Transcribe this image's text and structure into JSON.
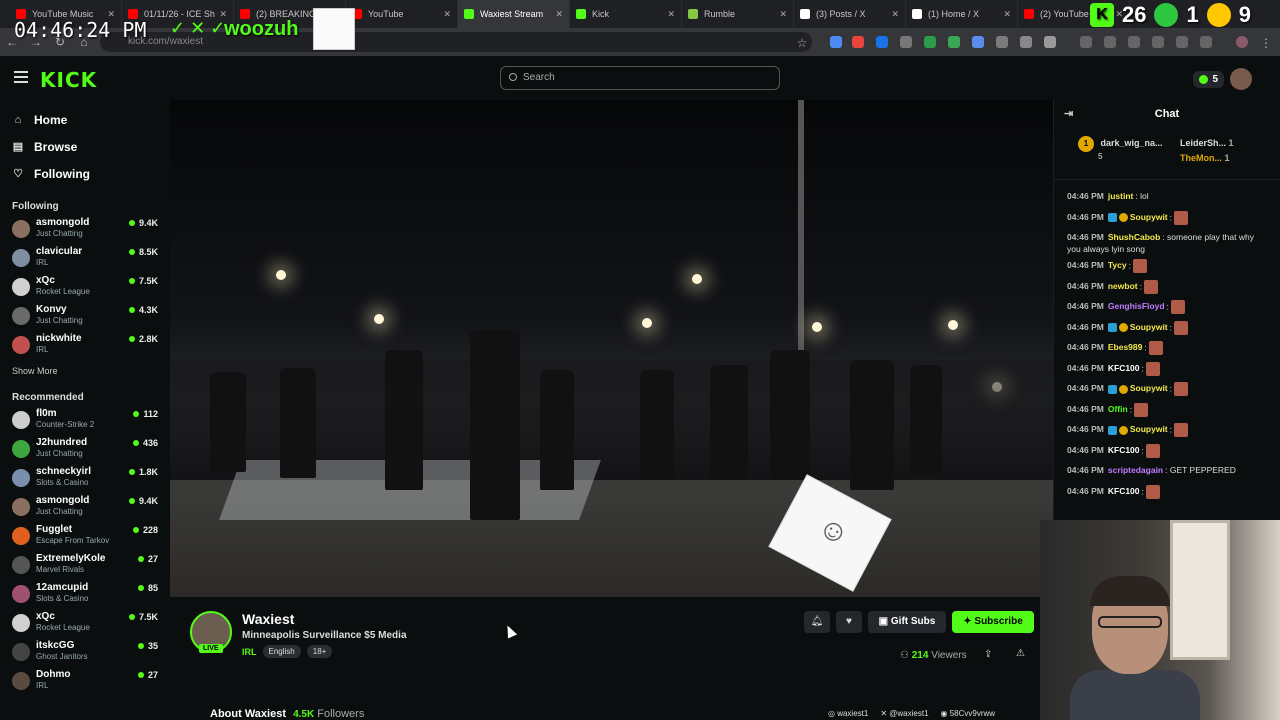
{
  "browser": {
    "tabs": [
      {
        "label": "YouTube Music",
        "color": "#ff0000",
        "active": false
      },
      {
        "label": "01/11/26 - ICE Sh",
        "color": "#ff0000",
        "active": false
      },
      {
        "label": "(2) BREAKING",
        "color": "#ff0000",
        "active": false
      },
      {
        "label": "YouTube",
        "color": "#ff0000",
        "active": false
      },
      {
        "label": "Waxiest Stream",
        "color": "#53fc18",
        "active": true
      },
      {
        "label": "Kick",
        "color": "#53fc18",
        "active": false
      },
      {
        "label": "Rumble",
        "color": "#85c742",
        "active": false
      },
      {
        "label": "(3) Posts / X",
        "color": "#ffffff",
        "active": false
      },
      {
        "label": "(1) Home / X",
        "color": "#ffffff",
        "active": false
      },
      {
        "label": "(2) YouTube",
        "color": "#ff0000",
        "active": false
      }
    ],
    "url": "kick.com/waxiest"
  },
  "overlay": {
    "clock": "04:46:24 PM",
    "handle": "woozuh",
    "counts": [
      "26",
      "1",
      "9"
    ]
  },
  "header": {
    "logo": "KICK",
    "search_placeholder": "Search",
    "kick_count": "5"
  },
  "sidebar": {
    "nav": [
      {
        "label": "Home",
        "icon": "home-icon",
        "glyph": "⌂"
      },
      {
        "label": "Browse",
        "icon": "browse-icon",
        "glyph": "▤"
      },
      {
        "label": "Following",
        "icon": "heart-icon",
        "glyph": "♡"
      }
    ],
    "following_title": "Following",
    "following": [
      {
        "name": "asmongold",
        "category": "Just Chatting",
        "viewers": "9.4K",
        "color": "#8a6f5f"
      },
      {
        "name": "clavicular",
        "category": "IRL",
        "viewers": "8.5K",
        "color": "#7d8fa0"
      },
      {
        "name": "xQc",
        "category": "Rocket League",
        "viewers": "7.5K",
        "color": "#d0d0d0"
      },
      {
        "name": "Konvy",
        "category": "Just Chatting",
        "viewers": "4.3K",
        "color": "#6a6a6a"
      },
      {
        "name": "nickwhite",
        "category": "IRL",
        "viewers": "2.8K",
        "color": "#c0504d"
      }
    ],
    "show_more": "Show More",
    "recommended_title": "Recommended",
    "recommended": [
      {
        "name": "fl0m",
        "category": "Counter-Strike 2",
        "viewers": "112",
        "color": "#cccccc"
      },
      {
        "name": "J2hundred",
        "category": "Just Chatting",
        "viewers": "436",
        "color": "#3fa53f"
      },
      {
        "name": "schneckyirl",
        "category": "Slots & Casino",
        "viewers": "1.8K",
        "color": "#7a8fb0"
      },
      {
        "name": "asmongold",
        "category": "Just Chatting",
        "viewers": "9.4K",
        "color": "#8a6f5f"
      },
      {
        "name": "Fugglet",
        "category": "Escape From Tarkov",
        "viewers": "228",
        "color": "#e06020"
      },
      {
        "name": "ExtremelyKole",
        "category": "Marvel Rivals",
        "viewers": "27",
        "color": "#555555"
      },
      {
        "name": "12amcupid",
        "category": "Slots & Casino",
        "viewers": "85",
        "color": "#a05070"
      },
      {
        "name": "xQc",
        "category": "Rocket League",
        "viewers": "7.5K",
        "color": "#d0d0d0"
      },
      {
        "name": "itskcGG",
        "category": "Ghost Janitors",
        "viewers": "35",
        "color": "#444444"
      },
      {
        "name": "Dohmo",
        "category": "IRL",
        "viewers": "27",
        "color": "#5a4a40"
      }
    ]
  },
  "stream": {
    "name": "Waxiest",
    "live_label": "LIVE",
    "title": "Minneapolis Surveillance $5 Media",
    "category": "IRL",
    "tags": [
      "English",
      "18+"
    ],
    "gift_label": "Gift Subs",
    "subscribe_label": "Subscribe",
    "viewers": "214",
    "viewers_label": "Viewers",
    "about_label": "About Waxiest",
    "followers": "4.5K",
    "followers_label": "Followers",
    "socials": [
      "waxiest1",
      "@waxiest1",
      "58Cvv9vrww"
    ]
  },
  "chat": {
    "title": "Chat",
    "leaderboard": {
      "first": {
        "rank": "1",
        "name": "dark_wig_na...",
        "count": "5"
      },
      "second": {
        "name": "LeiderSh...",
        "count": "1"
      },
      "third": {
        "name": "TheMon...",
        "count": "1"
      }
    },
    "messages": [
      {
        "time": "04:46 PM",
        "user": "justint",
        "color": "#f2e94e",
        "text": "lol",
        "emote": false
      },
      {
        "time": "04:46 PM",
        "user": "Soupywit",
        "color": "#f2e94e",
        "text": "",
        "emote": true
      },
      {
        "time": "04:46 PM",
        "user": "ShushCabob",
        "color": "#f2e94e",
        "text": "someone play that why you always lyin song",
        "emote": false
      },
      {
        "time": "04:46 PM",
        "user": "Tycy",
        "color": "#f2e94e",
        "text": "",
        "emote": true
      },
      {
        "time": "04:46 PM",
        "user": "newbot",
        "color": "#f2e94e",
        "text": "",
        "emote": true
      },
      {
        "time": "04:46 PM",
        "user": "GenghisFloyd",
        "color": "#c07cff",
        "text": "",
        "emote": true
      },
      {
        "time": "04:46 PM",
        "user": "Soupywit",
        "color": "#f2e94e",
        "text": "",
        "emote": true
      },
      {
        "time": "04:46 PM",
        "user": "Ebes989",
        "color": "#f2e94e",
        "text": "",
        "emote": true
      },
      {
        "time": "04:46 PM",
        "user": "KFC100",
        "color": "#ffffff",
        "text": "",
        "emote": true
      },
      {
        "time": "04:46 PM",
        "user": "Soupywit",
        "color": "#f2e94e",
        "text": "",
        "emote": true
      },
      {
        "time": "04:46 PM",
        "user": "Offin",
        "color": "#53fc18",
        "text": "",
        "emote": true
      },
      {
        "time": "04:46 PM",
        "user": "Soupywit",
        "color": "#f2e94e",
        "text": "",
        "emote": true
      },
      {
        "time": "04:46 PM",
        "user": "KFC100",
        "color": "#ffffff",
        "text": "",
        "emote": true
      },
      {
        "time": "04:46 PM",
        "user": "scriptedagain",
        "color": "#c07cff",
        "text": "GET PEPPERED",
        "emote": false
      },
      {
        "time": "04:46 PM",
        "user": "KFC100",
        "color": "#ffffff",
        "text": "",
        "emote": true
      }
    ]
  },
  "colors": {
    "brand": "#53fc18",
    "background": "#0b0e0f"
  }
}
